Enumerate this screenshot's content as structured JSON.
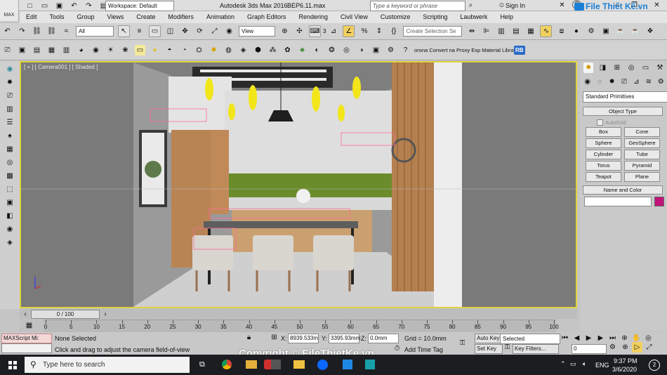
{
  "titlebar": {
    "app_icon": "MAX",
    "workspace": "Workspace: Default",
    "title": "Autodesk 3ds Max 2016",
    "file": "BEP6.11.max",
    "search_placeholder": "Type a keyword or phrase",
    "sign_in": "Sign In",
    "help": "?",
    "watermark_brand": "File Thiết Kế.vn"
  },
  "menu": [
    "Edit",
    "Tools",
    "Group",
    "Views",
    "Create",
    "Modifiers",
    "Animation",
    "Graph Editors",
    "Rendering",
    "Civil View",
    "Customize",
    "Scripting",
    "Laubwerk",
    "Help"
  ],
  "toolbar": {
    "filter": "All",
    "ref_coord": "View",
    "snap_value": "3",
    "selection_set_placeholder": "Create Selection Se"
  },
  "toolbar2": {
    "plugin_text": "orona Convert na Proxy Exp Material Library",
    "rb_badge": "RB"
  },
  "viewport": {
    "label": "[ + ] [ Camera001 ] [ Shaded ]"
  },
  "command_panel": {
    "category": "Standard Primitives",
    "object_type_header": "Object Type",
    "autogrid": "AutoGrid",
    "buttons": [
      "Box",
      "Cone",
      "Sphere",
      "GeoSphere",
      "Cylinder",
      "Tube",
      "Torus",
      "Pyramid",
      "Teapot",
      "Plane"
    ],
    "name_color_header": "Name and Color",
    "color": "#c2127a"
  },
  "timeline": {
    "frame": "0 / 100",
    "ticks": [
      "0",
      "5",
      "10",
      "15",
      "20",
      "25",
      "30",
      "35",
      "40",
      "45",
      "50",
      "55",
      "60",
      "65",
      "70",
      "75",
      "80",
      "85",
      "90",
      "95",
      "100"
    ]
  },
  "status": {
    "maxscript": "MAXScript Mi:",
    "selection": "None Selected",
    "prompt": "Click and drag to adjust the camera field-of-view",
    "x_label": "X:",
    "x_value": "8939.533m",
    "y_label": "Y:",
    "y_value": "3395.93mm",
    "z_label": "Z:",
    "z_value": "0.0mm",
    "grid": "Grid = 10.0mm",
    "add_time_tag": "Add Time Tag",
    "auto_key": "Auto Key",
    "set_key": "Set Key",
    "key_mode": "Selected",
    "key_filters": "Key Filters...",
    "frame_field": "0"
  },
  "watermark": "Copyright © FileThietKe.vn",
  "taskbar": {
    "search_placeholder": "Type here to search",
    "time": "9:37 PM",
    "date": "3/6/2020",
    "lang": "ENG",
    "notif_count": "2"
  },
  "colors": {
    "viewport_border": "#e0d23a",
    "taskbar": "#1c1d21",
    "brand_blue": "#1a7fd6"
  }
}
